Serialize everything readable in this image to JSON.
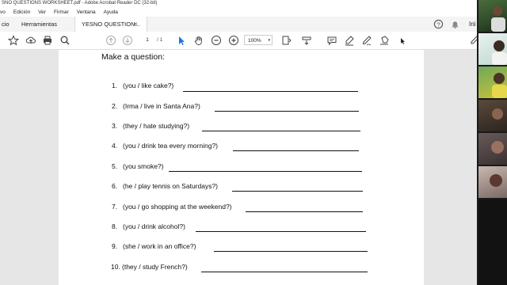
{
  "window": {
    "title": "SNO QUESTIONS WORKSHEET.pdf - Adobe Acrobat Reader DC (32-bit)"
  },
  "menu": [
    "vo",
    "Edición",
    "Ver",
    "Firmar",
    "Ventana",
    "Ayuda"
  ],
  "tabs": [
    {
      "label": "cio"
    },
    {
      "label": "Herramientas"
    },
    {
      "label": "YESNO QUESTION...",
      "active": true
    }
  ],
  "tab_close": "×",
  "header_right": {
    "sign_in": "Ini"
  },
  "toolbar": {
    "page_current": "1",
    "page_total": "/ 1",
    "zoom": "100%",
    "zoom_arrow": "▾"
  },
  "document": {
    "heading": "Make a question:",
    "questions": [
      {
        "num": "1.",
        "text": "(you / like cake?)"
      },
      {
        "num": "2.",
        "text": "(Irma / live in Santa Ana?)"
      },
      {
        "num": "3.",
        "text": "(they / hate studying?)"
      },
      {
        "num": "4.",
        "text": "(you / drink tea every morning?)"
      },
      {
        "num": "5.",
        "text": "(you smoke?)"
      },
      {
        "num": "6.",
        "text": "(he / play tennis on Saturdays?)"
      },
      {
        "num": "7.",
        "text": "(you / go shopping at the weekend?)"
      },
      {
        "num": "8.",
        "text": "(you / drink alcohol?)"
      },
      {
        "num": "9.",
        "text": "(she / work in an office?)"
      },
      {
        "num": "10.",
        "text": "(they / study French?)"
      }
    ]
  },
  "icons": {
    "toolbar": [
      "star-icon",
      "cloud-upload-icon",
      "print-icon",
      "search-icon",
      "page-up-icon",
      "page-down-icon",
      "select-arrow-icon",
      "hand-icon",
      "zoom-out-icon",
      "zoom-in-icon",
      "fit-page-icon",
      "scroll-mode-icon",
      "comment-icon",
      "highlight-icon",
      "sign-icon",
      "stamp-icon"
    ],
    "header": [
      "help-icon",
      "bell-icon",
      "user-icon"
    ]
  },
  "colors": {
    "accent": "#1a73e8",
    "toolbar_bg": "#ffffff",
    "tab_bg": "#f4f4f4",
    "doc_bg": "#e6e6e6"
  }
}
